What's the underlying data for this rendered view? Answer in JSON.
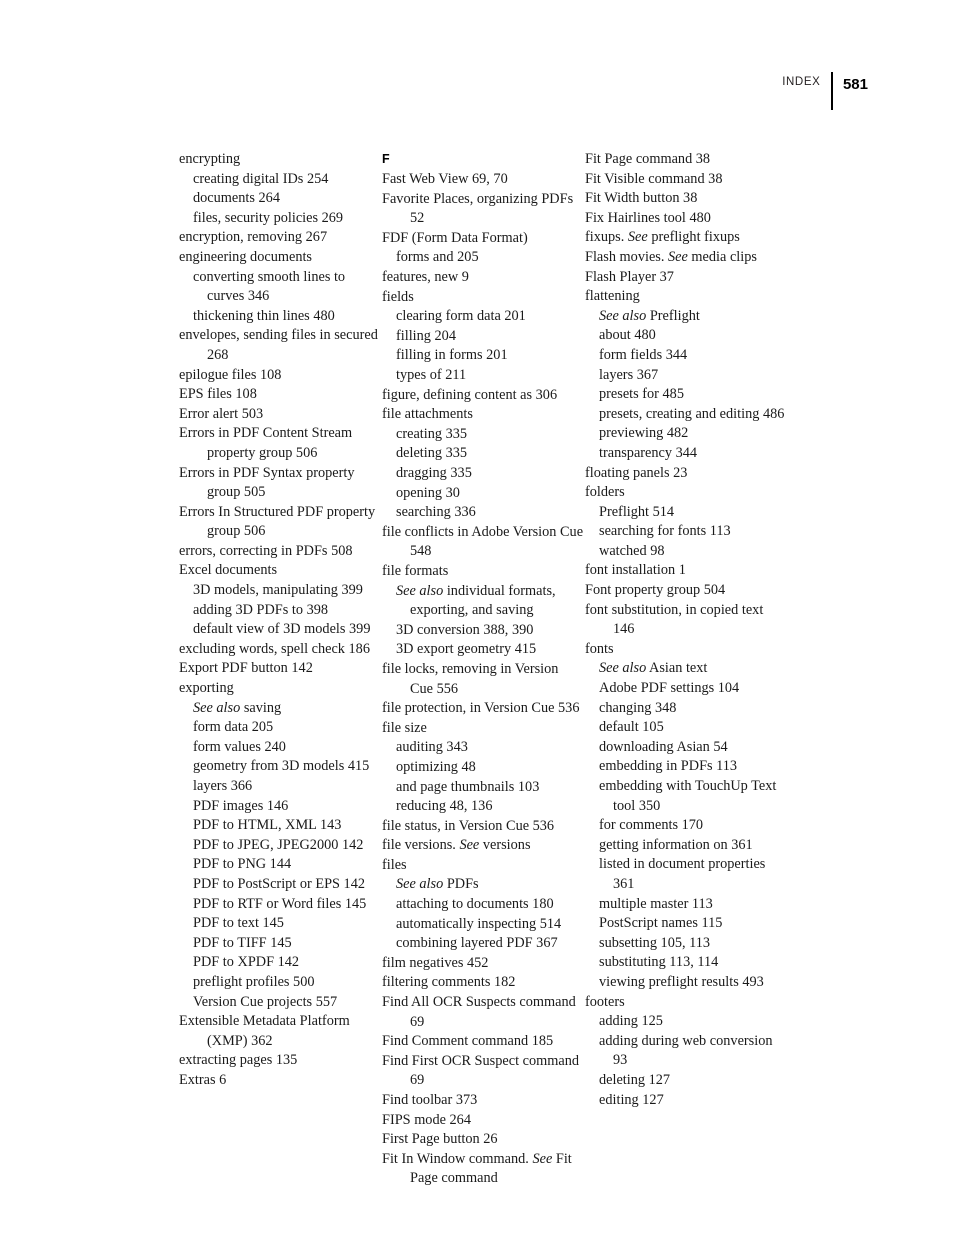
{
  "header": {
    "running_head": "INDEX",
    "folio": "581"
  },
  "columns": [
    {
      "id": "column-1",
      "entries": [
        {
          "level": 0,
          "text": "encrypting"
        },
        {
          "level": 1,
          "text": "creating digital IDs 254"
        },
        {
          "level": 1,
          "text": "documents 264"
        },
        {
          "level": 1,
          "text": "files, security policies 269"
        },
        {
          "level": 0,
          "text": "encryption, removing 267"
        },
        {
          "level": 0,
          "text": "engineering documents"
        },
        {
          "level": 1,
          "text": "converting smooth lines to curves 346"
        },
        {
          "level": 1,
          "text": "thickening thin lines 480"
        },
        {
          "level": 0,
          "text": "envelopes, sending files in secured 268"
        },
        {
          "level": 0,
          "text": "epilogue files 108"
        },
        {
          "level": 0,
          "text": "EPS files 108"
        },
        {
          "level": 0,
          "text": "Error alert 503"
        },
        {
          "level": 0,
          "text": "Errors in PDF Content Stream property group 506"
        },
        {
          "level": 0,
          "text": "Errors in PDF Syntax property group 505"
        },
        {
          "level": 0,
          "text": "Errors In Structured PDF property group 506"
        },
        {
          "level": 0,
          "text": "errors, correcting in PDFs 508"
        },
        {
          "level": 0,
          "text": "Excel documents"
        },
        {
          "level": 1,
          "text": "3D models, manipulating 399"
        },
        {
          "level": 1,
          "text": "adding 3D PDFs to 398"
        },
        {
          "level": 1,
          "text": "default view of 3D models 399"
        },
        {
          "level": 0,
          "text": "excluding words, spell check 186"
        },
        {
          "level": 0,
          "text": "Export PDF button 142"
        },
        {
          "level": 0,
          "text": "exporting"
        },
        {
          "level": 1,
          "italic_prefix": "See also",
          "text": " saving"
        },
        {
          "level": 1,
          "text": "form data 205"
        },
        {
          "level": 1,
          "text": "form values 240"
        },
        {
          "level": 1,
          "text": "geometry from 3D models 415"
        },
        {
          "level": 1,
          "text": "layers 366"
        },
        {
          "level": 1,
          "text": "PDF images 146"
        },
        {
          "level": 1,
          "text": "PDF to HTML, XML 143"
        },
        {
          "level": 1,
          "text": "PDF to JPEG, JPEG2000 142"
        },
        {
          "level": 1,
          "text": "PDF to PNG 144"
        },
        {
          "level": 1,
          "text": "PDF to PostScript or EPS 142"
        },
        {
          "level": 1,
          "text": "PDF to RTF or Word files 145"
        },
        {
          "level": 1,
          "text": "PDF to text 145"
        },
        {
          "level": 1,
          "text": "PDF to TIFF 145"
        },
        {
          "level": 1,
          "text": "PDF to XPDF 142"
        },
        {
          "level": 1,
          "text": "preflight profiles 500"
        },
        {
          "level": 1,
          "text": "Version Cue projects 557"
        },
        {
          "level": 0,
          "text": "Extensible Metadata Platform (XMP) 362"
        },
        {
          "level": 0,
          "text": "extracting pages 135"
        },
        {
          "level": 0,
          "text": "Extras 6"
        }
      ]
    },
    {
      "id": "column-2",
      "section_letter": "F",
      "entries": [
        {
          "level": 0,
          "text": "Fast Web View 69, 70"
        },
        {
          "level": 0,
          "text": "Favorite Places, organizing PDFs 52"
        },
        {
          "level": 0,
          "text": "FDF (Form Data Format)"
        },
        {
          "level": 1,
          "text": "forms and 205"
        },
        {
          "level": 0,
          "text": "features, new 9"
        },
        {
          "level": 0,
          "text": "fields"
        },
        {
          "level": 1,
          "text": "clearing form data 201"
        },
        {
          "level": 1,
          "text": "filling 204"
        },
        {
          "level": 1,
          "text": "filling in forms 201"
        },
        {
          "level": 1,
          "text": "types of 211"
        },
        {
          "level": 0,
          "text": "figure, defining content as 306"
        },
        {
          "level": 0,
          "text": "file attachments"
        },
        {
          "level": 1,
          "text": "creating 335"
        },
        {
          "level": 1,
          "text": "deleting 335"
        },
        {
          "level": 1,
          "text": "dragging 335"
        },
        {
          "level": 1,
          "text": "opening 30"
        },
        {
          "level": 1,
          "text": "searching 336"
        },
        {
          "level": 0,
          "text": "file conflicts in Adobe Version Cue 548"
        },
        {
          "level": 0,
          "text": "file formats"
        },
        {
          "level": 1,
          "italic_prefix": "See also",
          "text": " individual formats, exporting, and saving"
        },
        {
          "level": 1,
          "text": "3D conversion 388, 390"
        },
        {
          "level": 1,
          "text": "3D export geometry 415"
        },
        {
          "level": 0,
          "text": "file locks, removing in Version Cue 556"
        },
        {
          "level": 0,
          "text": "file protection, in Version Cue 536"
        },
        {
          "level": 0,
          "text": "file size"
        },
        {
          "level": 1,
          "text": "auditing 343"
        },
        {
          "level": 1,
          "text": "optimizing 48"
        },
        {
          "level": 1,
          "text": "and page thumbnails 103"
        },
        {
          "level": 1,
          "text": "reducing 48, 136"
        },
        {
          "level": 0,
          "text": "file status, in Version Cue 536"
        },
        {
          "level": 0,
          "text_before": "file versions. ",
          "italic_mid": "See",
          "text": " versions"
        },
        {
          "level": 0,
          "text": "files"
        },
        {
          "level": 1,
          "italic_prefix": "See also",
          "text": " PDFs"
        },
        {
          "level": 1,
          "text": "attaching to documents 180"
        },
        {
          "level": 1,
          "text": "automatically inspecting 514"
        },
        {
          "level": 1,
          "text": "combining layered PDF 367"
        },
        {
          "level": 0,
          "text": "film negatives 452"
        },
        {
          "level": 0,
          "text": "filtering comments 182"
        },
        {
          "level": 0,
          "text": "Find All OCR Suspects command 69"
        },
        {
          "level": 0,
          "text": "Find Comment command 185"
        },
        {
          "level": 0,
          "text": "Find First OCR Suspect command 69"
        },
        {
          "level": 0,
          "text": "Find toolbar 373"
        },
        {
          "level": 0,
          "text": "FIPS mode 264"
        },
        {
          "level": 0,
          "text": "First Page button 26"
        },
        {
          "level": 0,
          "text_before": "Fit In Window command. ",
          "italic_mid": "See",
          "text": " Fit Page command"
        }
      ]
    },
    {
      "id": "column-3",
      "entries": [
        {
          "level": 0,
          "text": "Fit Page command 38"
        },
        {
          "level": 0,
          "text": "Fit Visible command 38"
        },
        {
          "level": 0,
          "text": "Fit Width button 38"
        },
        {
          "level": 0,
          "text": "Fix Hairlines tool 480"
        },
        {
          "level": 0,
          "text_before": "fixups. ",
          "italic_mid": "See",
          "text": " preflight fixups"
        },
        {
          "level": 0,
          "text_before": "Flash movies. ",
          "italic_mid": "See",
          "text": " media clips"
        },
        {
          "level": 0,
          "text": "Flash Player 37"
        },
        {
          "level": 0,
          "text": "flattening"
        },
        {
          "level": 1,
          "italic_prefix": "See also",
          "text": " Preflight"
        },
        {
          "level": 1,
          "text": "about 480"
        },
        {
          "level": 1,
          "text": "form fields 344"
        },
        {
          "level": 1,
          "text": "layers 367"
        },
        {
          "level": 1,
          "text": "presets for 485"
        },
        {
          "level": 1,
          "text": "presets, creating and editing 486"
        },
        {
          "level": 1,
          "text": "previewing 482"
        },
        {
          "level": 1,
          "text": "transparency 344"
        },
        {
          "level": 0,
          "text": "floating panels 23"
        },
        {
          "level": 0,
          "text": "folders"
        },
        {
          "level": 1,
          "text": "Preflight 514"
        },
        {
          "level": 1,
          "text": "searching for fonts 113"
        },
        {
          "level": 1,
          "text": "watched 98"
        },
        {
          "level": 0,
          "text": "font installation 1"
        },
        {
          "level": 0,
          "text": "Font property group 504"
        },
        {
          "level": 0,
          "text": "font substitution, in copied text 146"
        },
        {
          "level": 0,
          "text": "fonts"
        },
        {
          "level": 1,
          "italic_prefix": "See also",
          "text": " Asian text"
        },
        {
          "level": 1,
          "text": "Adobe PDF settings 104"
        },
        {
          "level": 1,
          "text": "changing 348"
        },
        {
          "level": 1,
          "text": "default 105"
        },
        {
          "level": 1,
          "text": "downloading Asian 54"
        },
        {
          "level": 1,
          "text": "embedding in PDFs 113"
        },
        {
          "level": 1,
          "text": "embedding with TouchUp Text tool 350"
        },
        {
          "level": 1,
          "text": "for comments 170"
        },
        {
          "level": 1,
          "text": "getting information on 361"
        },
        {
          "level": 1,
          "text": "listed in document properties 361"
        },
        {
          "level": 1,
          "text": "multiple master 113"
        },
        {
          "level": 1,
          "text": "PostScript names 115"
        },
        {
          "level": 1,
          "text": "subsetting 105, 113"
        },
        {
          "level": 1,
          "text": "substituting 113, 114"
        },
        {
          "level": 1,
          "text": "viewing preflight results 493"
        },
        {
          "level": 0,
          "text": "footers"
        },
        {
          "level": 1,
          "text": "adding 125"
        },
        {
          "level": 1,
          "text": "adding during web conversion 93"
        },
        {
          "level": 1,
          "text": "deleting 127"
        },
        {
          "level": 1,
          "text": "editing 127"
        }
      ]
    }
  ]
}
